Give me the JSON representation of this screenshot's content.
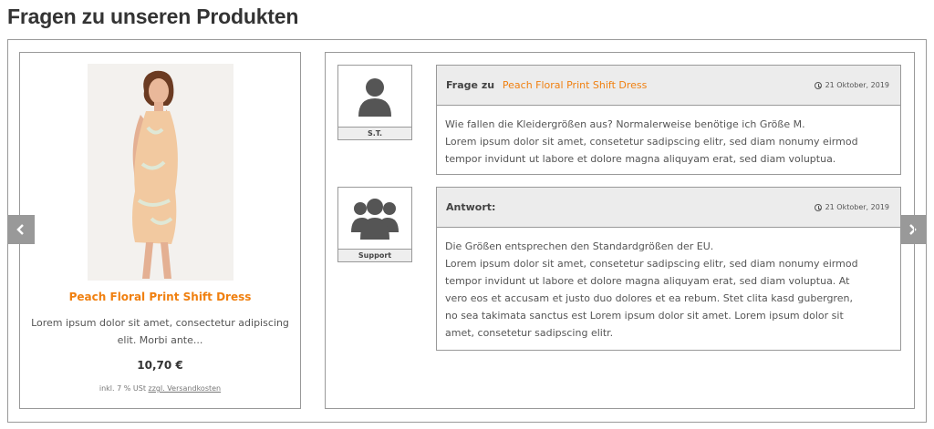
{
  "page": {
    "title": "Fragen zu unseren Produkten"
  },
  "navigation": {
    "prev_icon": "chevron-left-icon",
    "next_icon": "chevron-right-icon"
  },
  "product": {
    "name": "Peach Floral Print Shift Dress",
    "description": "Lorem ipsum dolor sit amet, consectetur adipiscing elit. Morbi ante...",
    "price": "10,70 €",
    "tax_note": "inkl. 7 % USt",
    "shipping_link": "zzgl. Versandkosten"
  },
  "question": {
    "author": "S.T.",
    "prefix": "Frage zu",
    "product_link": "Peach Floral Print Shift Dress",
    "date": "21 Oktober, 2019",
    "lines": [
      "Wie fallen die Kleidergrößen aus? Normalerweise benötige ich Größe M.",
      "Lorem ipsum dolor sit amet, consetetur sadipscing elitr, sed diam nonumy eirmod",
      "tempor invidunt ut labore et dolore magna aliquyam erat, sed diam voluptua."
    ]
  },
  "answer": {
    "author": "Support",
    "heading": "Antwort:",
    "date": "21 Oktober, 2019",
    "lines": [
      "Die Größen entsprechen den Standardgrößen der EU.",
      "Lorem ipsum dolor sit amet, consetetur sadipscing elitr, sed diam nonumy eirmod",
      "tempor invidunt ut labore et dolore magna aliquyam erat, sed diam voluptua. At",
      "vero eos et accusam et justo duo dolores et ea rebum. Stet clita kasd gubergren,",
      "no sea takimata sanctus est Lorem ipsum dolor sit amet. Lorem ipsum dolor sit",
      "amet, consetetur sadipscing elitr."
    ]
  },
  "colors": {
    "accent": "#f08010",
    "border": "#999999",
    "header_bg": "#ececec"
  }
}
